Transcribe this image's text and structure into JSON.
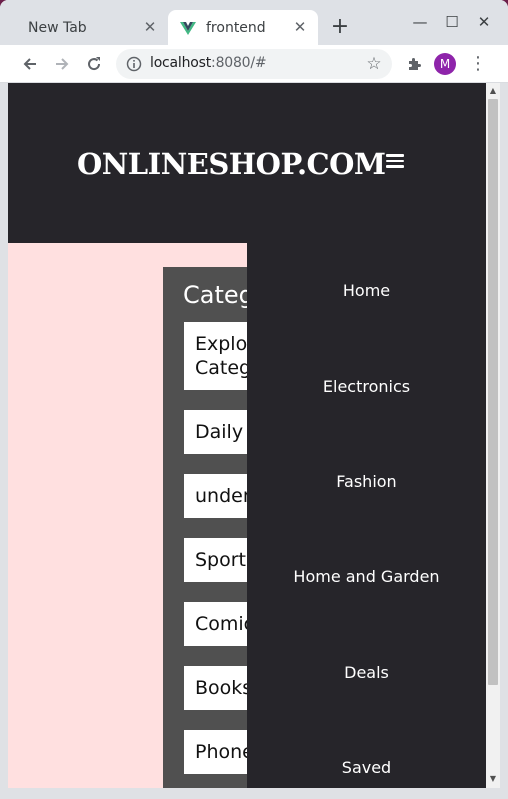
{
  "browser": {
    "tabs": [
      {
        "title": "New Tab",
        "active": false
      },
      {
        "title": "frontend",
        "active": true
      }
    ],
    "url_host": "localhost",
    "url_rest": ":8080/#",
    "profile_initial": "M",
    "profile_color": "#8e24aa"
  },
  "header": {
    "brand": "ONLINESHOP.COM",
    "bg_color": "#26252a"
  },
  "categories": {
    "title": "Categ",
    "items": [
      "Explo\nCateg",
      "Daily",
      "under",
      "Sport",
      "Comic",
      "Books",
      "Phone"
    ]
  },
  "menu": {
    "items": [
      "Home",
      "Electronics",
      "Fashion",
      "Home and Garden",
      "Deals",
      "Saved"
    ]
  },
  "colors": {
    "page_bg": "#ffe0e0",
    "panel_bg": "#505050",
    "accent_vue_green": "#41b883"
  },
  "icons": {
    "back": "arrow-left-icon",
    "forward": "arrow-right-icon",
    "reload": "reload-icon",
    "info": "info-icon",
    "bookmark": "star-icon",
    "extensions": "puzzle-icon",
    "menu": "kebab-menu-icon"
  }
}
